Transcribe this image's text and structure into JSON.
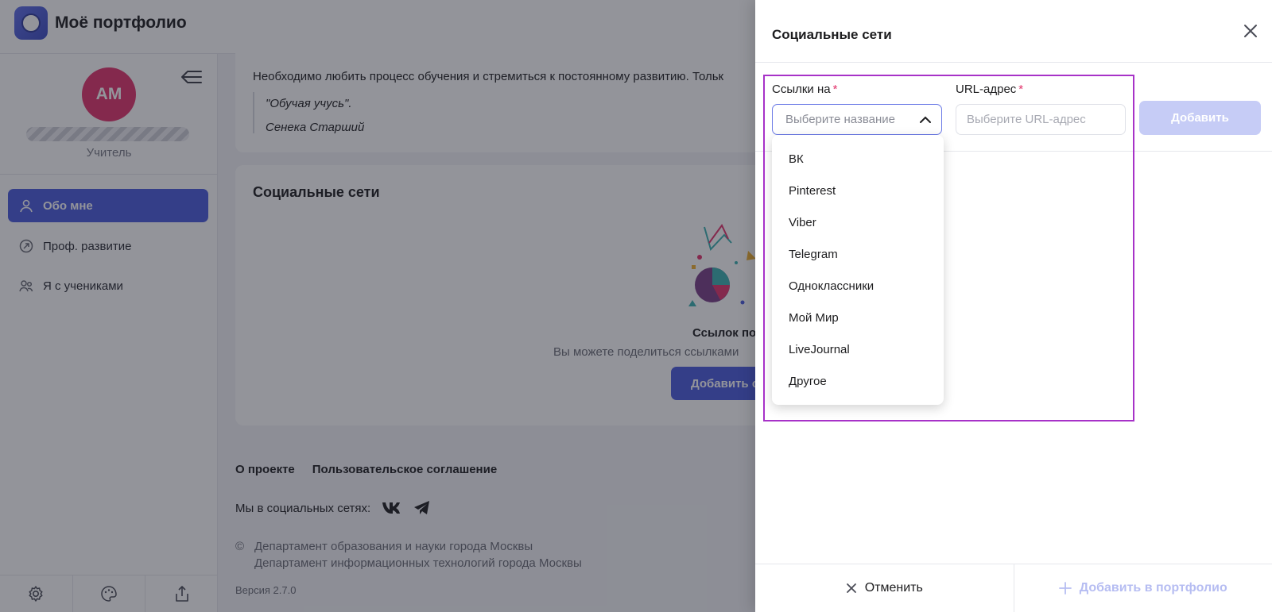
{
  "app": {
    "title": "Моё портфолио"
  },
  "profile": {
    "initials": "АМ",
    "role": "Учитель"
  },
  "sidebar": {
    "items": [
      {
        "label": "Обо мне",
        "icon": "user-icon"
      },
      {
        "label": "Проф. развитие",
        "icon": "compass-icon"
      },
      {
        "label": "Я с учениками",
        "icon": "users-icon"
      }
    ],
    "bottom_icons": [
      "gear-icon",
      "palette-icon",
      "share-icon"
    ]
  },
  "main": {
    "about_text": "Необходимо любить процесс обучения и стремиться к постоянному развитию. Тольк",
    "quote_line1": "\"Обучая учусь\".",
    "quote_line2": "Сенека Старший",
    "social_title": "Социальные сети",
    "empty_title": "Ссылок по",
    "empty_sub": "Вы можете поделиться ссылками",
    "add_button": "Добавить с"
  },
  "footer": {
    "about_link": "О проекте",
    "agreement_link": "Пользовательское соглашение",
    "social_label": "Мы в социальных сетях:",
    "copyright_symbol": "©",
    "copy_line1": "Департамент образования и науки города Москвы",
    "copy_line2": "Департамент информационных технологий города Москвы",
    "version": "Версия 2.7.0"
  },
  "modal": {
    "title": "Социальные сети",
    "link_label": "Ссылки на",
    "url_label": "URL-адрес",
    "required_mark": "*",
    "select_placeholder": "Выберите название",
    "url_placeholder": "Выберите URL-адрес",
    "add_label": "Добавить",
    "cancel_label": "Отменить",
    "add_portfolio_label": "Добавить в портфолио",
    "options": [
      "ВК",
      "Pinterest",
      "Viber",
      "Telegram",
      "Одноклассники",
      "Мой Мир",
      "LiveJournal",
      "Другое"
    ]
  },
  "colors": {
    "accent": "#4a5bdc",
    "avatar": "#e2336b",
    "highlight": "#a732c8",
    "disabled_accent": "#c6ccf6"
  }
}
